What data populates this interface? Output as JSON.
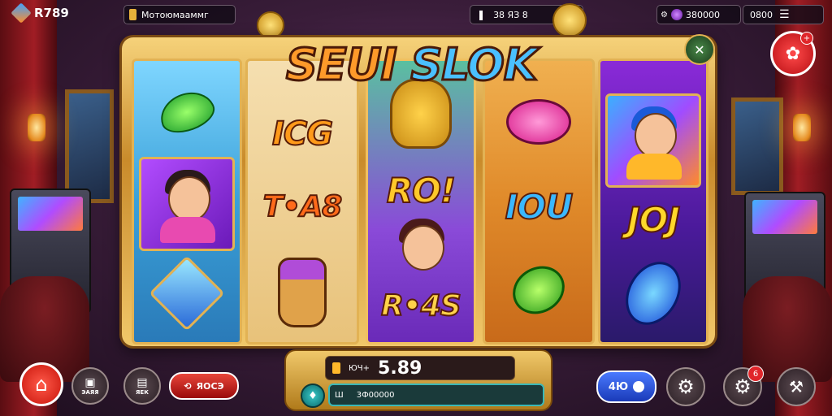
{
  "top_bar": {
    "logo_text": "R789",
    "account_label": "Мотоюмааммг",
    "balance_display": "38 ЯЗ 8",
    "gems_display": "380000",
    "credits_display": "0800"
  },
  "game": {
    "title_part1": "SEUI",
    "title_part2": "SLOK",
    "title_colors": {
      "part1": "#ff9a2a",
      "part2_s": "#4ac0ff",
      "part2_rest": "#ffe14a"
    }
  },
  "reels": [
    {
      "symbols": [
        "green-leaf",
        "girl-character",
        "blue-gem"
      ]
    },
    {
      "symbols": [
        "ICG",
        "T-A8",
        "purple-mask"
      ]
    },
    {
      "symbols": [
        "golden-goblin",
        "RO!",
        "R-4S"
      ]
    },
    {
      "symbols": [
        "pink-blob",
        "IOU",
        "green-leaf"
      ]
    },
    {
      "symbols": [
        "boy-character",
        "JOJ",
        "blue-gem"
      ]
    }
  ],
  "reel_text": {
    "reel2_top": "ICG",
    "reel2_mid": "T•A8",
    "reel3_mid": "RO!",
    "reel3_bot": "R•4S",
    "reel4_mid": "IOU",
    "reel5_mid": "JOJ"
  },
  "bet_panel": {
    "bet_label": "ЮЧ+",
    "bet_value": "5.89",
    "win_label": "Ш",
    "win_value": "3Ф00000"
  },
  "controls": {
    "menu_label": "ЭАЯЯ",
    "hold_label": "ЯЕК",
    "auto_label": "ЯОСЭ",
    "spin_label": "4Ю",
    "settings_badge": "6",
    "profile_badge": "+"
  },
  "colors": {
    "accent_red": "#e0262a",
    "gold": "#e2b254",
    "bet_teal": "#1d8a8a"
  }
}
